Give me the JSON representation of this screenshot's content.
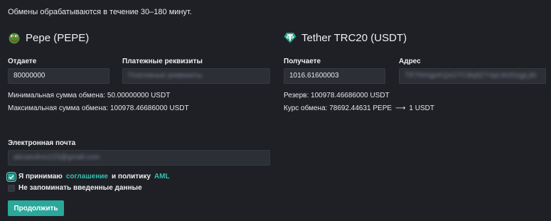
{
  "notice": "Обмены обрабатываются в течение 30–180 минут.",
  "give": {
    "coin_name": "Pepe (PEPE)",
    "icon": "pepe-frog-icon",
    "amount_label": "Отдаете",
    "amount_value": "80000000",
    "requisites_label": "Платежные реквизиты",
    "requisites_placeholder": "Платежные реквизиты",
    "min_text": "Минимальная сумма обмена: 50.00000000 USDT",
    "max_text": "Максимальная сумма обмена: 100978.46686000 USDT"
  },
  "receive": {
    "coin_name": "Tether TRC20 (USDT)",
    "icon": "tether-icon",
    "amount_label": "Получаете",
    "amount_value": "1016.61600003",
    "address_label": "Адрес",
    "address_value": "TR7NHqjeKQxGTCi8q8ZY4pL8otSzgjLj6t",
    "reserve_text": "Резерв: 100978.46686000 USDT",
    "rate_left": "Курс обмена: 78692.44631 PEPE",
    "rate_right": "1 USDT"
  },
  "email": {
    "label": "Электронная почта",
    "value": "alexandrov123@gmail.com"
  },
  "agreement": {
    "prefix": "Я принимаю",
    "link1": "соглашение",
    "middle": "и политику",
    "link2": "AML",
    "checked": true
  },
  "remember": {
    "label": "Не запоминать введенные данные",
    "checked": false
  },
  "submit_label": "Продолжить",
  "colors": {
    "accent": "#2aa89a",
    "link": "#35c0b0",
    "background": "#1e2026",
    "input": "#2c2f36"
  }
}
